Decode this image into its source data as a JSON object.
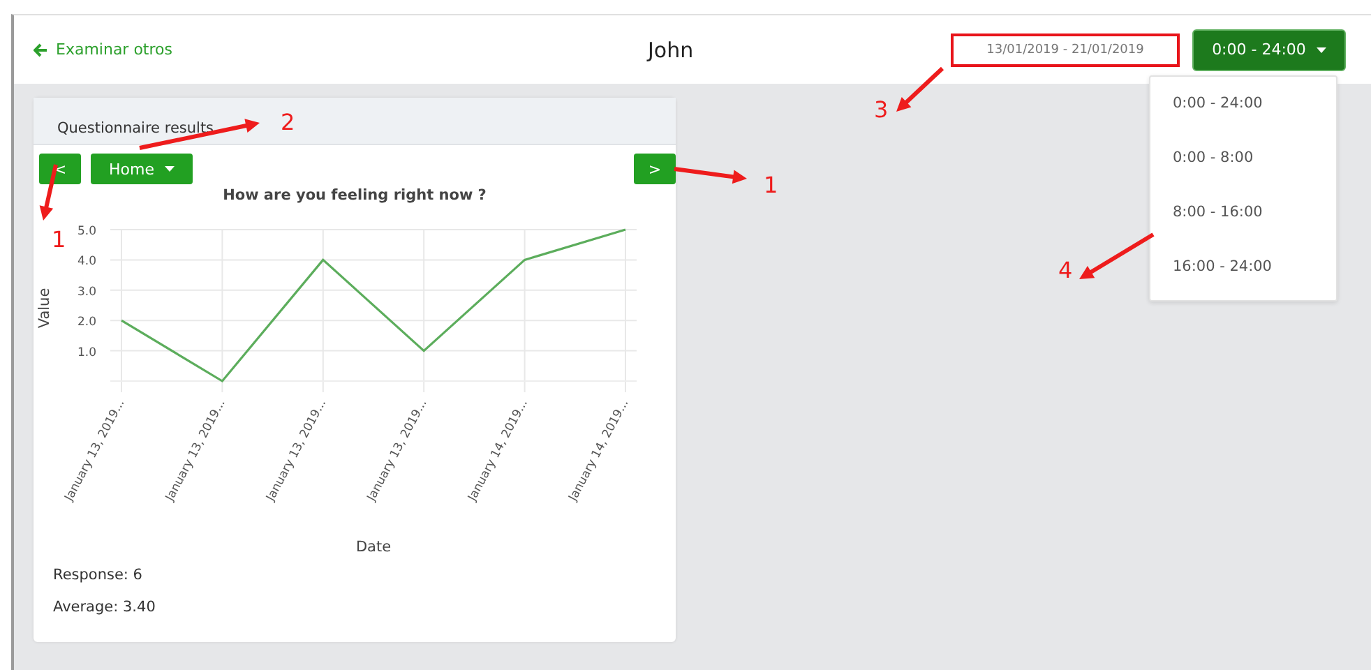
{
  "header": {
    "back_link": "Examinar otros",
    "title": "John",
    "date_range": {
      "value": "13/01/2019 - 21/01/2019",
      "highlighted": true
    },
    "time_button": "0:00 - 24:00",
    "time_menu": [
      "0:00 - 24:00",
      "0:00 - 8:00",
      "8:00 - 16:00",
      "16:00 - 24:00"
    ]
  },
  "card": {
    "title": "Questionnaire results",
    "prev_button": "<",
    "next_button": ">",
    "category_button": "Home",
    "chart_data": {
      "type": "line",
      "title": "How are you feeling right now ?",
      "xlabel": "Date",
      "ylabel": "Value",
      "categories": [
        "January 13, 2019...",
        "January 13, 2019...",
        "January 13, 2019...",
        "January 13, 2019...",
        "January 14, 2019...",
        "January 14, 2019..."
      ],
      "series": [
        {
          "color": "#5cad5c",
          "values": [
            2,
            0,
            4,
            1,
            4,
            5
          ]
        }
      ],
      "grid": true,
      "ylim": [
        0,
        5
      ],
      "yticks": [
        {
          "value": 1,
          "label": "1.0"
        },
        {
          "value": 2,
          "label": "2.0"
        },
        {
          "value": 3,
          "label": "3.0"
        },
        {
          "value": 4,
          "label": "4.0"
        },
        {
          "value": 5,
          "label": "5.0"
        }
      ]
    },
    "stats": [
      "Response: 6",
      "Average: 3.40"
    ]
  },
  "annotations": [
    {
      "label": "1"
    },
    {
      "label": "2"
    },
    {
      "label": "1"
    },
    {
      "label": "3"
    },
    {
      "label": "4"
    }
  ]
}
